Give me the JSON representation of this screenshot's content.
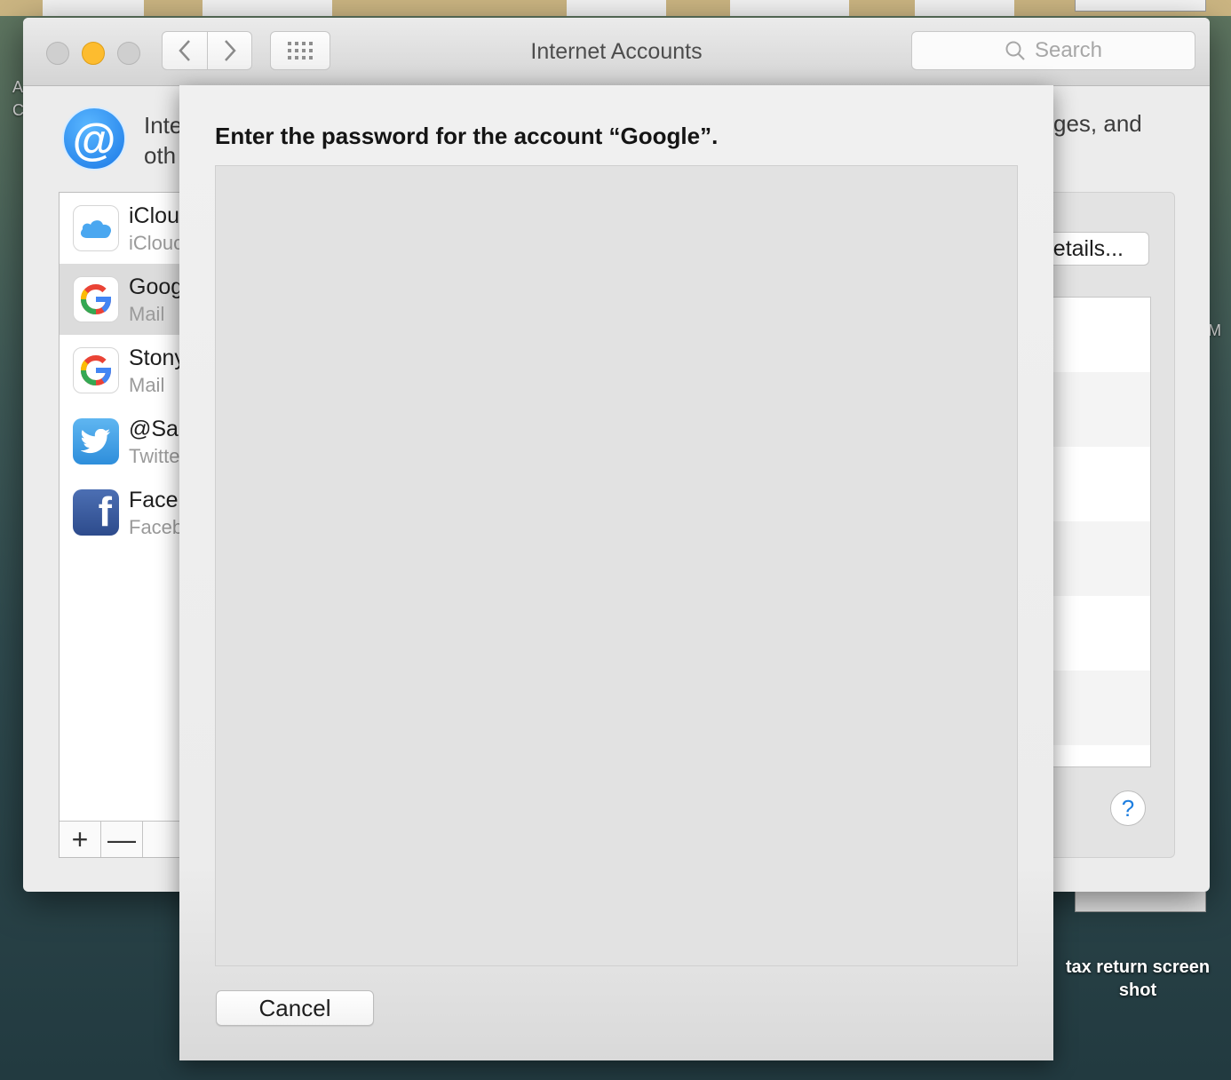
{
  "desktop": {
    "file_label": "tax return screen shot",
    "edge_text_right_top": "M",
    "edge_text_left_a": "A",
    "edge_text_left_c": "C"
  },
  "window": {
    "title": "Internet Accounts",
    "search_placeholder": "Search",
    "description_left_line1": "Inte",
    "description_left_line2": "oth",
    "description_right": "ges, and",
    "details_button_label": "etails...",
    "help_label": "?"
  },
  "accounts": [
    {
      "name": "iClou",
      "sub": "iClouc",
      "icon": "icloud-icon"
    },
    {
      "name": "Goog",
      "sub": "Mail",
      "icon": "google-icon",
      "selected": true
    },
    {
      "name": "Stony",
      "sub": "Mail",
      "icon": "google-icon"
    },
    {
      "name": "@Sai",
      "sub": "Twitte",
      "icon": "twitter-icon"
    },
    {
      "name": "Face",
      "sub": "Faceb",
      "icon": "facebook-icon"
    }
  ],
  "list_buttons": {
    "add": "+",
    "remove": "—"
  },
  "sheet": {
    "title": "Enter the password for the account “Google”.",
    "cancel_label": "Cancel"
  },
  "colors": {
    "minimize_button": "#fdbc2f",
    "at_icon": "#1a78e6",
    "help_icon": "#1d7ee0"
  }
}
